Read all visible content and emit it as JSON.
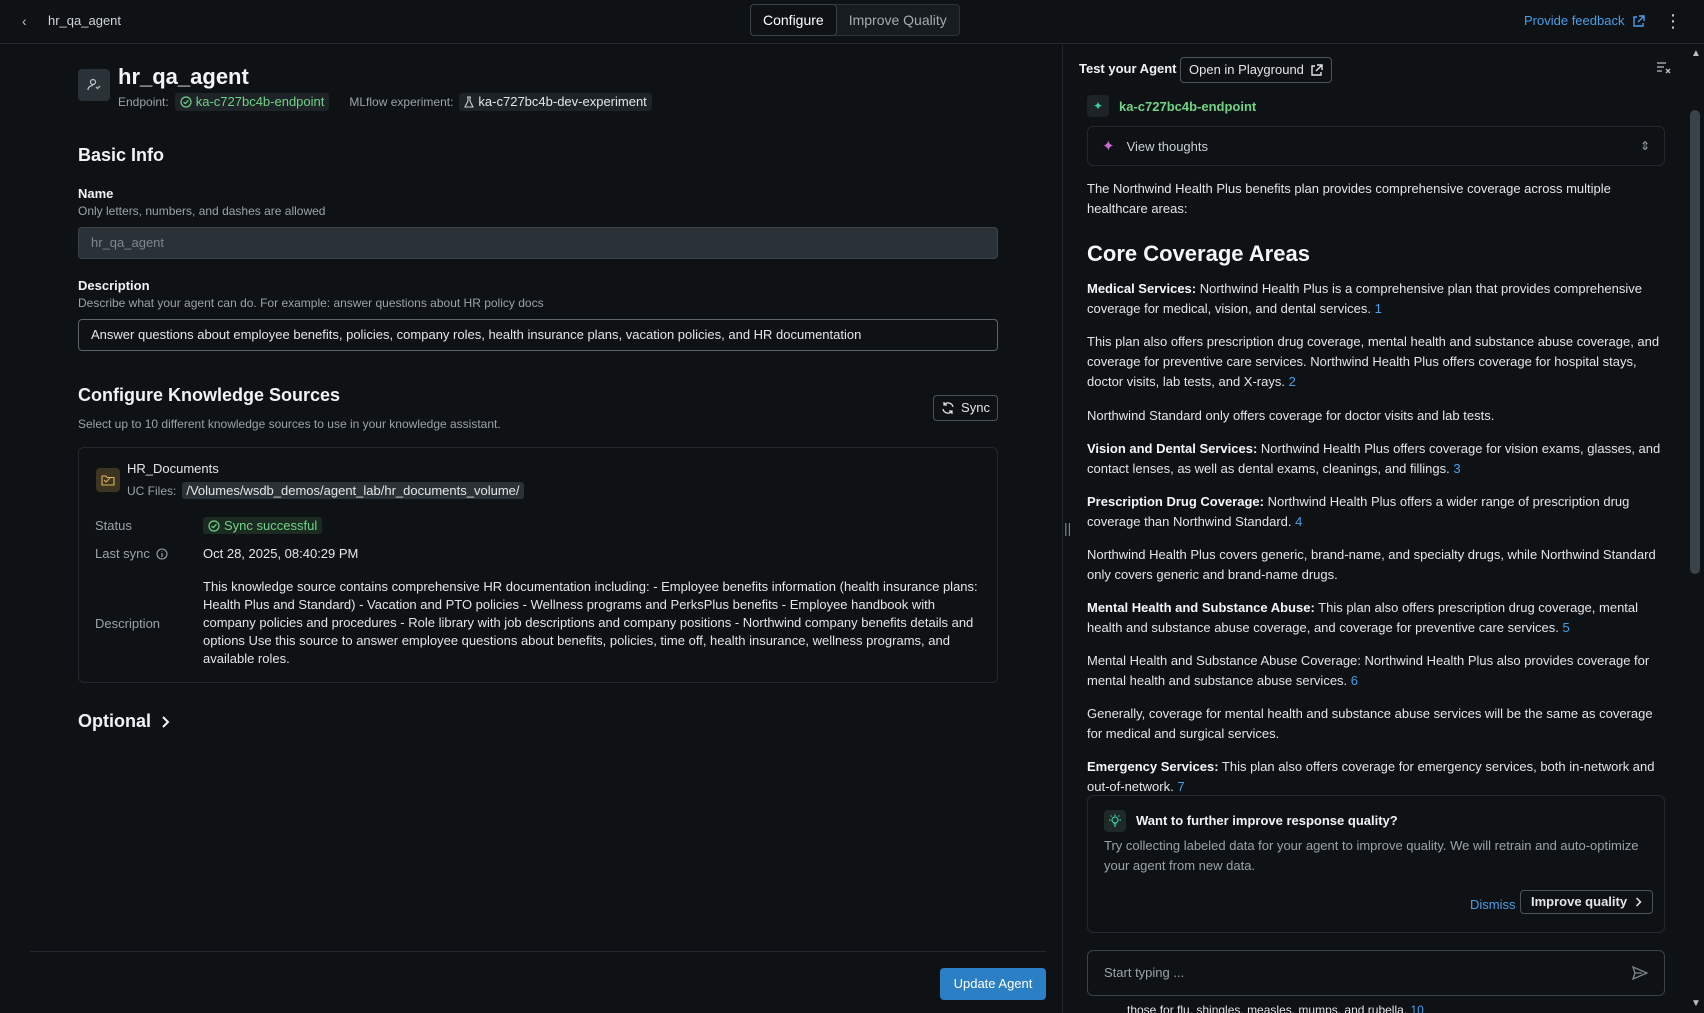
{
  "header": {
    "breadcrumb": "hr_qa_agent",
    "tabs": [
      "Configure",
      "Improve Quality"
    ],
    "feedback": "Provide feedback"
  },
  "agent": {
    "title": "hr_qa_agent",
    "endpoint_label": "Endpoint:",
    "endpoint": "ka-c727bc4b-endpoint",
    "experiment_label": "MLflow experiment:",
    "experiment": "ka-c727bc4b-dev-experiment"
  },
  "basic": {
    "heading": "Basic Info",
    "name_label": "Name",
    "name_hint": "Only letters, numbers, and dashes are allowed",
    "name_value": "hr_qa_agent",
    "desc_label": "Description",
    "desc_hint": "Describe what your agent can do. For example: answer questions about HR policy docs",
    "desc_value": "Answer questions about employee benefits, policies, company roles, health insurance plans, vacation policies, and HR documentation"
  },
  "knowledge": {
    "heading": "Configure Knowledge Sources",
    "hint": "Select up to 10 different knowledge sources to use in your knowledge assistant.",
    "sync": "Sync",
    "source": {
      "name": "HR_Documents",
      "path_label": "UC Files:",
      "path": "/Volumes/wsdb_demos/agent_lab/hr_documents_volume/",
      "status_label": "Status",
      "status": "Sync successful",
      "last_sync_label": "Last sync",
      "last_sync": "Oct 28, 2025, 08:40:29 PM",
      "desc_label": "Description",
      "description": "This knowledge source contains comprehensive HR documentation including: - Employee benefits information (health insurance plans: Health Plus and Standard) - Vacation and PTO policies - Wellness programs and PerksPlus benefits - Employee handbook with company policies and procedures - Role library with job descriptions and company positions - Northwind company benefits details and options Use this source to answer employee questions about benefits, policies, time off, health insurance, wellness programs, and available roles."
    }
  },
  "optional": "Optional",
  "update_button": "Update Agent",
  "test": {
    "title": "Test your Agent",
    "playground": "Open in Playground",
    "endpoint": "ka-c727bc4b-endpoint",
    "thoughts": "View thoughts",
    "intro": "The Northwind Health Plus benefits plan provides comprehensive coverage across multiple healthcare areas:",
    "core_heading": "Core Coverage Areas",
    "p1_bold": "Medical Services:",
    "p1": " Northwind Health Plus is a comprehensive plan that provides comprehensive coverage for medical, vision, and dental services. ",
    "p1_ref": "1",
    "p2": "This plan also offers prescription drug coverage, mental health and substance abuse coverage, and coverage for preventive care services. Northwind Health Plus offers coverage for hospital stays, doctor visits, lab tests, and X-rays. ",
    "p2_ref": "2",
    "p3": "Northwind Standard only offers coverage for doctor visits and lab tests.",
    "p4_bold": "Vision and Dental Services:",
    "p4": " Northwind Health Plus offers coverage for vision exams, glasses, and contact lenses, as well as dental exams, cleanings, and fillings. ",
    "p4_ref": "3",
    "p5_bold": "Prescription Drug Coverage:",
    "p5": " Northwind Health Plus offers a wider range of prescription drug coverage than Northwind Standard. ",
    "p5_ref": "4",
    "p6": "Northwind Health Plus covers generic, brand-name, and specialty drugs, while Northwind Standard only covers generic and brand-name drugs.",
    "p7_bold": "Mental Health and Substance Abuse:",
    "p7": " This plan also offers prescription drug coverage, mental health and substance abuse coverage, and coverage for preventive care services. ",
    "p7_ref": "5",
    "p8": "Mental Health and Substance Abuse Coverage: Northwind Health Plus also provides coverage for mental health and substance abuse services. ",
    "p8_ref": "6",
    "p9": "Generally, coverage for mental health and substance abuse services will be the same as coverage for medical and surgical services.",
    "p10_bold": "Emergency Services:",
    "p10": " This plan also offers coverage for emergency services, both in-network and out-of-network. ",
    "p10_ref": "7",
    "improve_title": "Want to further improve response quality?",
    "improve_text": "Try collecting labeled data for your agent to improve quality. We will retrain and auto-optimize your agent from new data.",
    "dismiss": "Dismiss",
    "improve_btn": "Improve quality",
    "input_placeholder": "Start typing ...",
    "trailing": "those for flu, shingles, measles, mumps, and rubella. ",
    "trailing_ref": "10"
  },
  "colors": {
    "accent_blue": "#4a9fe8",
    "success_green": "#70d386",
    "primary_button": "#2b7fc4"
  }
}
